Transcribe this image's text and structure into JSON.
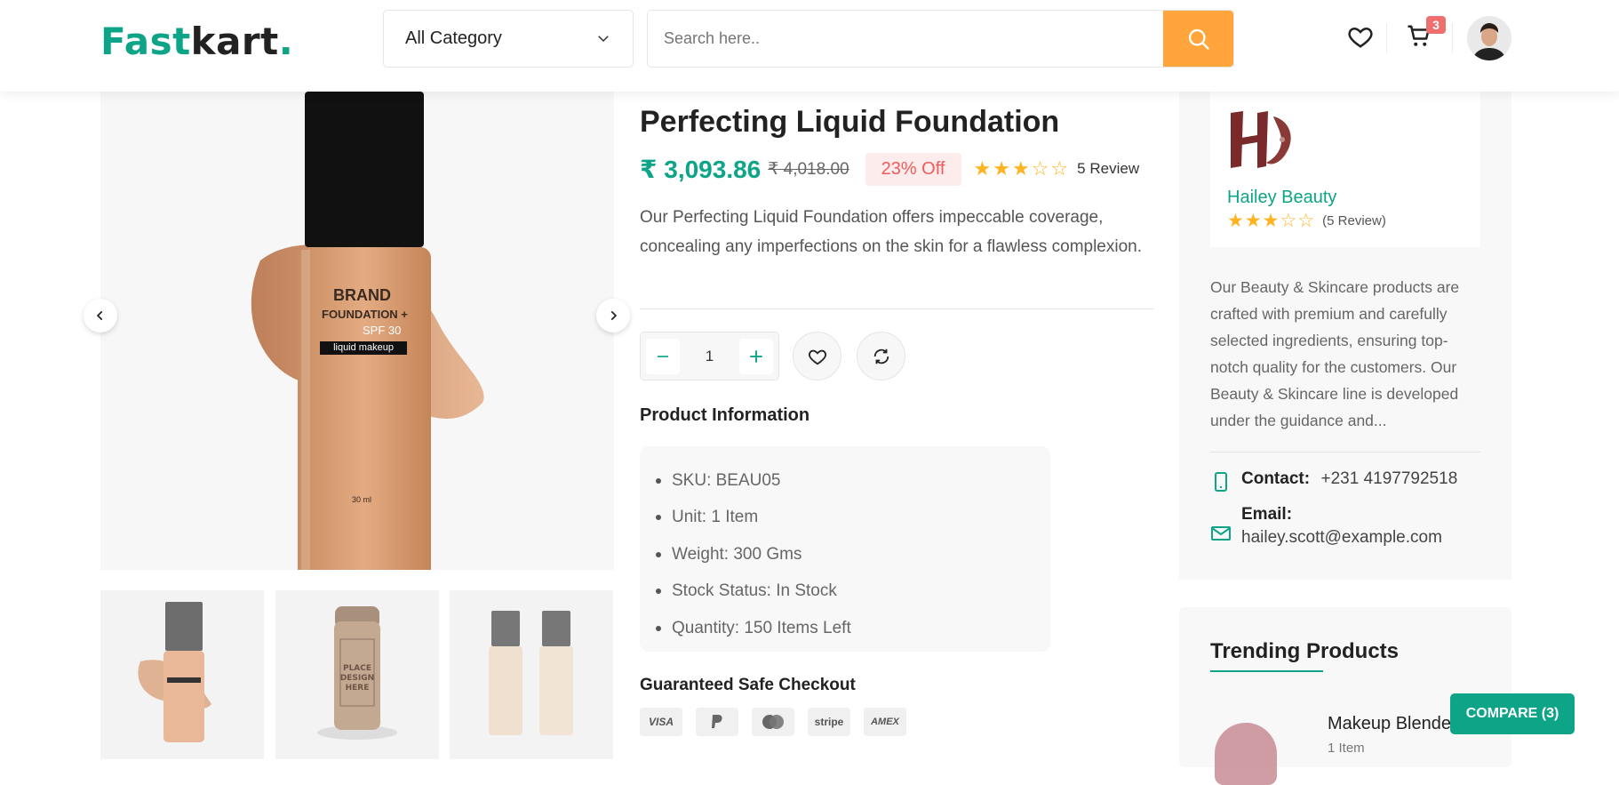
{
  "header": {
    "logo_part1": "Fast",
    "logo_part2": "kart",
    "logo_dot": ".",
    "category_label": "All Category",
    "search_placeholder": "Search here..",
    "cart_count": "3"
  },
  "product": {
    "title": "Perfecting Liquid Foundation",
    "price": "₹ 3,093.86",
    "old_price": "₹ 4,018.00",
    "discount": "23% Off",
    "rating": 3,
    "review_text": "5 Review",
    "description": "Our Perfecting Liquid Foundation offers impeccable coverage, concealing any imperfections on the skin for a flawless complexion.",
    "quantity": "1",
    "info_heading": "Product Information",
    "info": [
      "SKU: BEAU05",
      "Unit: 1 Item",
      "Weight: 300 Gms",
      "Stock Status: In Stock",
      "Quantity: 150 Items Left"
    ],
    "checkout_heading": "Guaranteed Safe Checkout",
    "payments": [
      "VISA",
      "PayPal",
      "MasterCard",
      "stripe",
      "AMEX"
    ]
  },
  "vendor": {
    "name": "Hailey Beauty",
    "rating": 3,
    "review_text": "(5 Review)",
    "description": "Our Beauty & Skincare products are crafted with premium and carefully selected ingredients, ensuring top-notch quality for the customers. Our Beauty & Skincare line is developed under the guidance and...",
    "contact_label": "Contact:",
    "contact_value": "+231 4197792518",
    "email_label": "Email:",
    "email_value": "hailey.scott@example.com"
  },
  "trending": {
    "title": "Trending Products",
    "item_name": "Makeup Blender",
    "item_unit": "1 Item"
  },
  "compare_label": "COMPARE (3)",
  "colors": {
    "brand_green": "#0da487",
    "search_orange": "#ffa53b",
    "star": "#ffb321",
    "discount_red": "#ef5a5a"
  }
}
